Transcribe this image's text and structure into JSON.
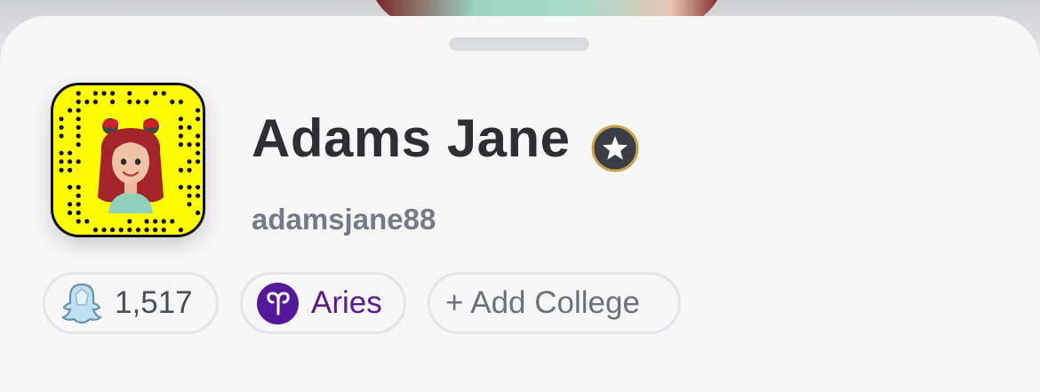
{
  "profile": {
    "display_name": "Adams Jane",
    "username": "adamsjane88",
    "badge_icon": "star-badge-icon"
  },
  "chips": {
    "score": {
      "icon": "ghost-score-icon",
      "value": "1,517"
    },
    "zodiac": {
      "icon": "aries-icon",
      "label": "Aries"
    },
    "college": {
      "label": "+ Add College"
    }
  },
  "colors": {
    "snapcode_yellow": "#fffc00",
    "sheet_background": "#f7f7f8",
    "name_text": "#2d2f33",
    "username_text": "#757b85",
    "zodiac_purple": "#55189a",
    "chip_border": "#e4e5e8"
  }
}
